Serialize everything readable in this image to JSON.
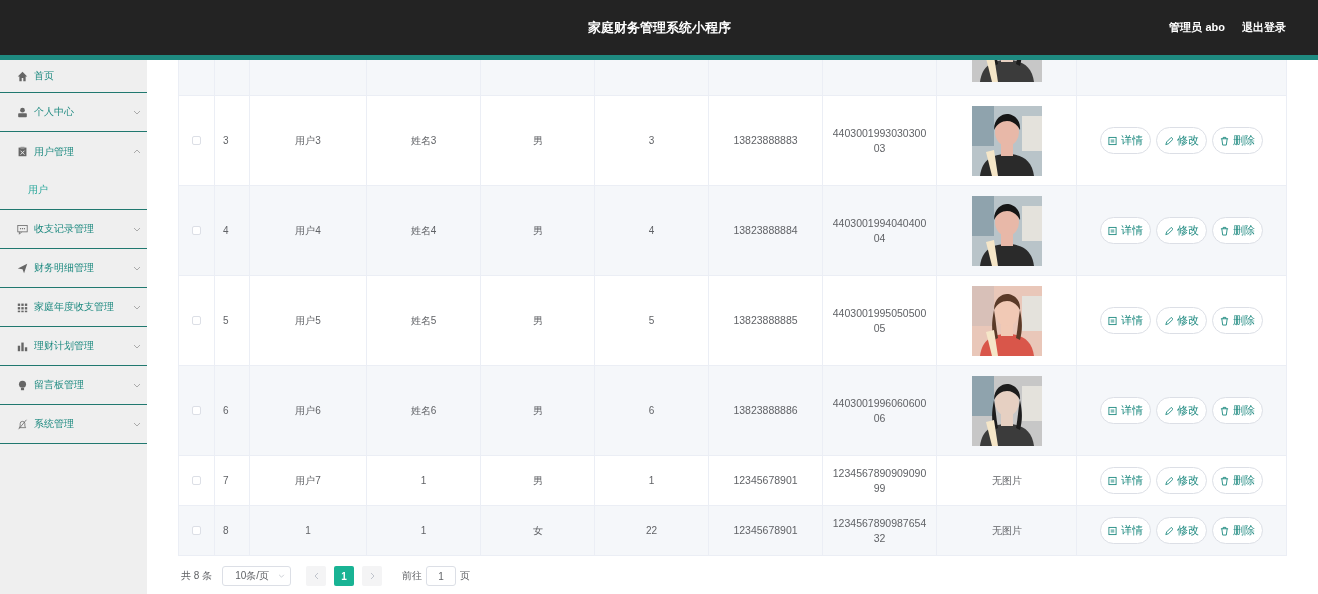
{
  "header": {
    "title": "家庭财务管理系统小程序",
    "user": "管理员 abo",
    "logout": "退出登录"
  },
  "sidebar": {
    "items": [
      {
        "label": "首页"
      },
      {
        "label": "个人中心",
        "expanded": false
      },
      {
        "label": "用户管理",
        "expanded": true,
        "children": [
          {
            "label": "用户"
          }
        ]
      },
      {
        "label": "收支记录管理",
        "expanded": false
      },
      {
        "label": "财务明细管理",
        "expanded": false
      },
      {
        "label": "家庭年度收支管理",
        "expanded": false
      },
      {
        "label": "理财计划管理",
        "expanded": false
      },
      {
        "label": "留言板管理",
        "expanded": false
      },
      {
        "label": "系统管理",
        "expanded": false
      }
    ]
  },
  "table": {
    "rows": [
      {
        "kind": "partial"
      },
      {
        "kind": "full",
        "checked": false,
        "index": "3",
        "username": "用户3",
        "name": "姓名3",
        "gender": "男",
        "age": "3",
        "phone": "13823888883",
        "id_number": "440300199303030003",
        "actions": [
          "详情",
          "修改",
          "删除"
        ]
      },
      {
        "kind": "full",
        "checked": false,
        "index": "4",
        "username": "用户4",
        "name": "姓名4",
        "gender": "男",
        "age": "4",
        "phone": "13823888884",
        "id_number": "440300199404040004",
        "actions": [
          "详情",
          "修改",
          "删除"
        ]
      },
      {
        "kind": "full",
        "checked": false,
        "index": "5",
        "username": "用户5",
        "name": "姓名5",
        "gender": "男",
        "age": "5",
        "phone": "13823888885",
        "id_number": "440300199505050005",
        "actions": [
          "详情",
          "修改",
          "删除"
        ]
      },
      {
        "kind": "full",
        "checked": false,
        "index": "6",
        "username": "用户6",
        "name": "姓名6",
        "gender": "男",
        "age": "6",
        "phone": "13823888886",
        "id_number": "440300199606060006",
        "actions": [
          "详情",
          "修改",
          "删除"
        ]
      },
      {
        "kind": "full",
        "checked": false,
        "index": "7",
        "username": "用户7",
        "name": "1",
        "gender": "男",
        "age": "1",
        "phone": "12345678901",
        "id_number": "123456789090909099",
        "photo_text": "无图片",
        "actions": [
          "详情",
          "修改",
          "删除"
        ]
      },
      {
        "kind": "full",
        "checked": false,
        "index": "8",
        "username": "1",
        "name": "1",
        "gender": "女",
        "age": "22",
        "phone": "12345678901",
        "id_number": "123456789098765432",
        "photo_text": "无图片",
        "actions": [
          "详情",
          "修改",
          "删除"
        ]
      }
    ]
  },
  "pagination": {
    "total": "共 8 条",
    "page_size": "10条/页",
    "pages": [
      {
        "label": "1",
        "selected": true
      }
    ],
    "goto_label": "前往",
    "goto_value": "1",
    "goto_suffix": "页"
  }
}
